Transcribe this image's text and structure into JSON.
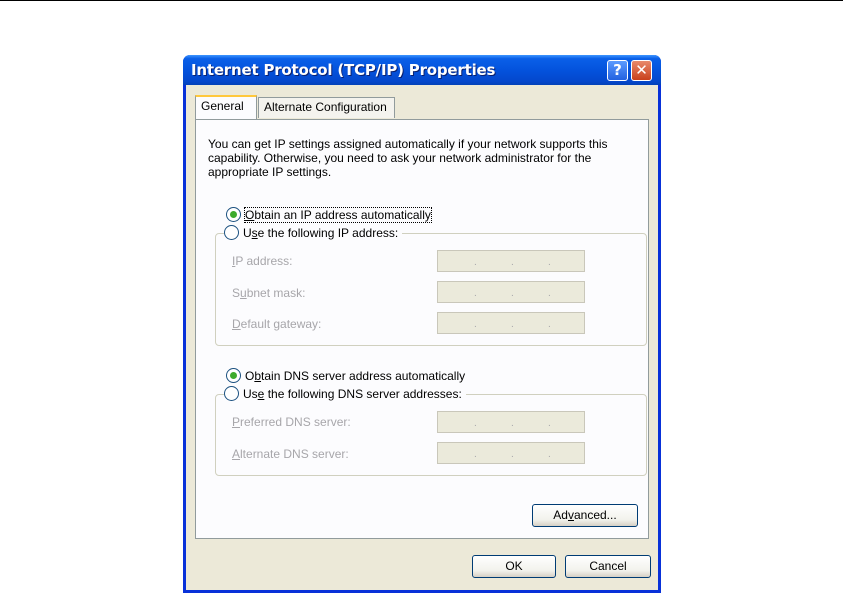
{
  "window": {
    "title": "Internet Protocol (TCP/IP) Properties",
    "help_glyph": "?",
    "close_glyph": "✕"
  },
  "tabs": [
    {
      "label": "General",
      "active": true
    },
    {
      "label": "Alternate Configuration",
      "active": false
    }
  ],
  "intro_text": "You can get IP settings assigned automatically if your network supports this capability. Otherwise, you need to ask your network administrator for the appropriate IP settings.",
  "ip_options": {
    "auto": {
      "pre": "",
      "key": "O",
      "post": "btain an IP address automatically",
      "checked": true
    },
    "manual": {
      "pre": "U",
      "key": "s",
      "post": "e the following IP address:",
      "checked": false
    }
  },
  "ip_fields": [
    {
      "pre": "",
      "key": "I",
      "post": "P address:",
      "value": ". . ."
    },
    {
      "pre": "S",
      "key": "u",
      "post": "bnet mask:",
      "value": ". . ."
    },
    {
      "pre": "",
      "key": "D",
      "post": "efault gateway:",
      "value": ". . ."
    }
  ],
  "dns_options": {
    "auto": {
      "pre": "O",
      "key": "b",
      "post": "tain DNS server address automatically",
      "checked": true
    },
    "manual": {
      "pre": "Us",
      "key": "e",
      "post": " the following DNS server addresses:",
      "checked": false
    }
  },
  "dns_fields": [
    {
      "pre": "",
      "key": "P",
      "post": "referred DNS server:",
      "value": ". . ."
    },
    {
      "pre": "",
      "key": "A",
      "post": "lternate DNS server:",
      "value": ". . ."
    }
  ],
  "buttons": {
    "advanced": {
      "pre": "Ad",
      "key": "v",
      "post": "anced..."
    },
    "ok": "OK",
    "cancel": "Cancel"
  }
}
